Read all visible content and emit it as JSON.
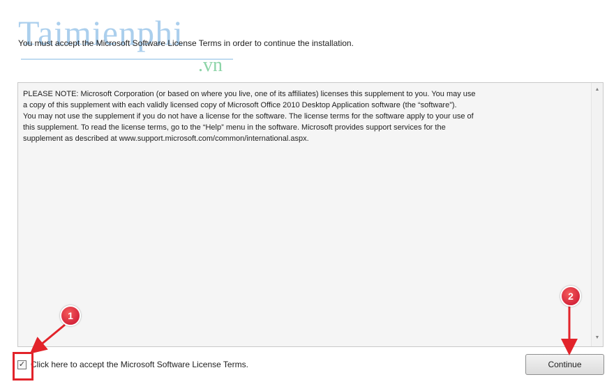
{
  "watermark": {
    "brand": "Taimienphi",
    "domain": ".vn"
  },
  "dialog": {
    "instruction": "You must accept the Microsoft Software License Terms in order to continue the installation.",
    "license_text": "PLEASE NOTE:  Microsoft Corporation (or based on where you live, one of its affiliates) licenses this supplement to you.  You may use\na copy of this supplement with each validly licensed copy of Microsoft Office 2010 Desktop Application software (the “software”).\nYou may not use the supplement if you do not have a license for the software.  The license terms for the software apply to your use of\nthis supplement.  To read the license terms, go to the “Help” menu in the software.  Microsoft provides support services for the\nsupplement as described at www.support.microsoft.com/common/international.aspx.",
    "accept_label": "Click here to accept the Microsoft Software License Terms.",
    "accept_checked": true,
    "continue_label": "Continue"
  },
  "annotations": {
    "step1": "1",
    "step2": "2",
    "color": "#e2232a"
  },
  "icons": {
    "scroll_up": "scroll-up-arrow-icon",
    "scroll_down": "scroll-down-arrow-icon",
    "checkmark": "checkmark-icon"
  }
}
